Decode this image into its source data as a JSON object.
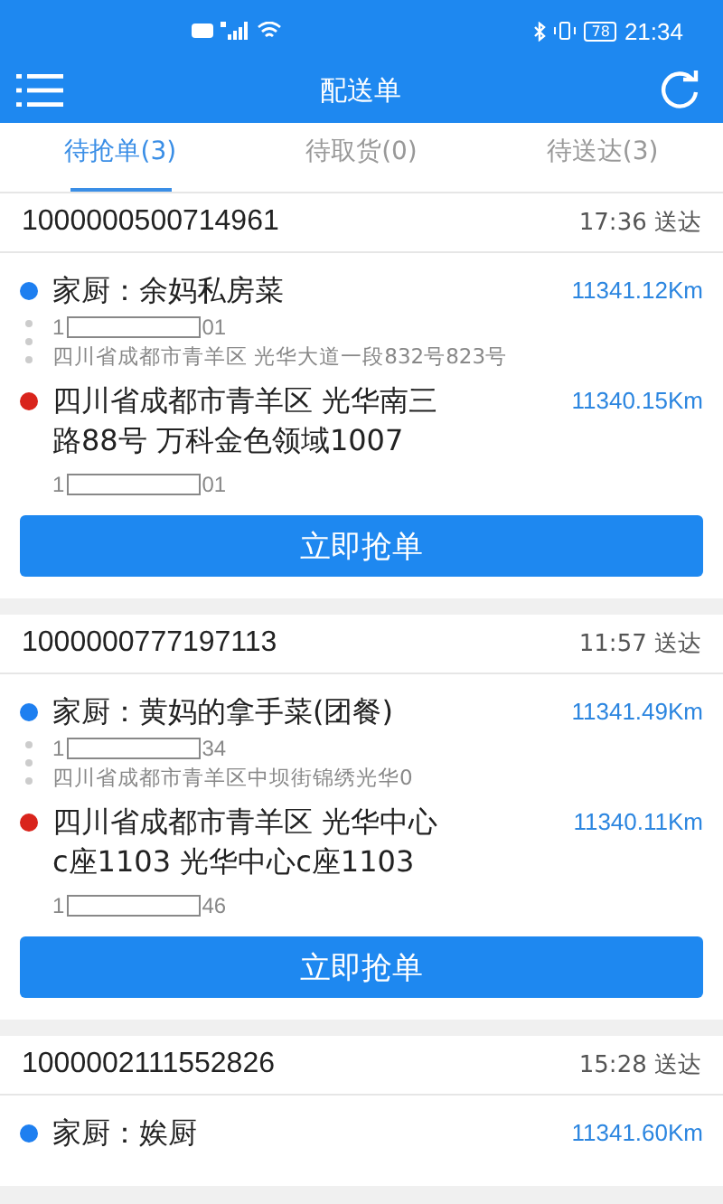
{
  "status_bar": {
    "battery": "78",
    "time": "21:34"
  },
  "header": {
    "title": "配送单"
  },
  "tabs": [
    {
      "label": "待抢单(3)",
      "selected": true
    },
    {
      "label": "待取货(0)",
      "selected": false
    },
    {
      "label": "待送达(3)",
      "selected": false
    }
  ],
  "orders": [
    {
      "number": "1000000500714961",
      "time": "17:36 送达",
      "pickup": {
        "name": "家厨：余妈私房菜",
        "distance": "11341.12Km",
        "phone_start": "1",
        "phone_end": "01",
        "address": "四川省成都市青羊区 光华大道一段832号823号"
      },
      "dropoff": {
        "address": "四川省成都市青羊区 光华南三路88号 万科金色领域1007",
        "distance": "11340.15Km",
        "phone_start": "1",
        "phone_end": "01"
      },
      "button": "立即抢单"
    },
    {
      "number": "1000000777197113",
      "time": "11:57 送达",
      "pickup": {
        "name": "家厨：黄妈的拿手菜(团餐)",
        "distance": "11341.49Km",
        "phone_start": "1",
        "phone_end": "34",
        "address": "四川省成都市青羊区中坝街锦绣光华0"
      },
      "dropoff": {
        "address": "四川省成都市青羊区 光华中心c座1103 光华中心c座1103",
        "distance": "11340.11Km",
        "phone_start": "1",
        "phone_end": "46"
      },
      "button": "立即抢单"
    },
    {
      "number": "1000002111552826",
      "time": "15:28 送达",
      "pickup": {
        "name": "家厨：娭厨",
        "distance": "11341.60Km"
      }
    }
  ]
}
